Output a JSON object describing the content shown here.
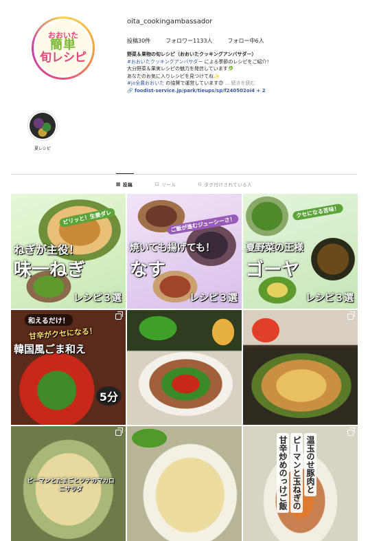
{
  "profile": {
    "avatar": {
      "line1": "おおいた",
      "line2": "簡単",
      "line3": "旬レシピ"
    },
    "username": "oita_cookingambassador",
    "stats": {
      "posts": "投稿30件",
      "followers": "フォロワー1133人",
      "following": "フォロー中6人"
    },
    "bio": {
      "name": "野菜＆果物の旬レシピ（おおいたクッキングアンバサダー）",
      "line2_tag": "#おおいたクッキングアンバサダー",
      "line2_rest": "による季節のレシピをご紹介！",
      "line3": "大分野菜＆果実レシピの魅力を発信しています🥬",
      "line4": "あなたのお気に入りレシピを見つけてね✨",
      "line5_tag": "#ja全農おおいた",
      "line5_rest": "の協賛で運営しています😊",
      "more": "... 続きを読む",
      "link": "foodist-service.jp/park/tieups/sp/f240502oi4 + 2"
    }
  },
  "highlight": {
    "label": "夏レシピ"
  },
  "tabs": {
    "posts": "投稿",
    "reels": "リール",
    "tagged": "タグ付けされている人"
  },
  "posts": [
    {
      "sub": "ピリッと！生姜ダレ",
      "title": "ねぎが主役！",
      "big": "味一ねぎ",
      "recipe": "レシピ３選",
      "bg": "#d7f0c8"
    },
    {
      "sub": "ご飯が進むジューシーさ！",
      "title": "焼いても揚げても！",
      "big": "なす",
      "recipe": "レシピ３選",
      "bg": "#e9d9f2"
    },
    {
      "sub": "クセになる苦味！",
      "title": "夏野菜の王様",
      "big": "ゴーヤ",
      "recipe": "レシピ３選",
      "bg": "#d9f0d0"
    },
    {
      "sub": "和えるだけ！",
      "title": "甘辛がクセになる！",
      "big": "韓国風ごま和え",
      "badge": "5分",
      "bg": "#7a2e1e"
    },
    {
      "bg": "#3c4a2c"
    },
    {
      "bg": "#4a3420"
    },
    {
      "caption": "ピーマンとたまごとツナのマカロニサラダ",
      "bg": "#8a9a5a"
    },
    {
      "bg": "#c9c5a0"
    },
    {
      "vertical1": "ピーマンと玉ねぎの",
      "vertical2": "温玉のせ豚肉と",
      "vertical3": "甘辛炒めのっけご飯",
      "bg": "#b5623a"
    }
  ]
}
